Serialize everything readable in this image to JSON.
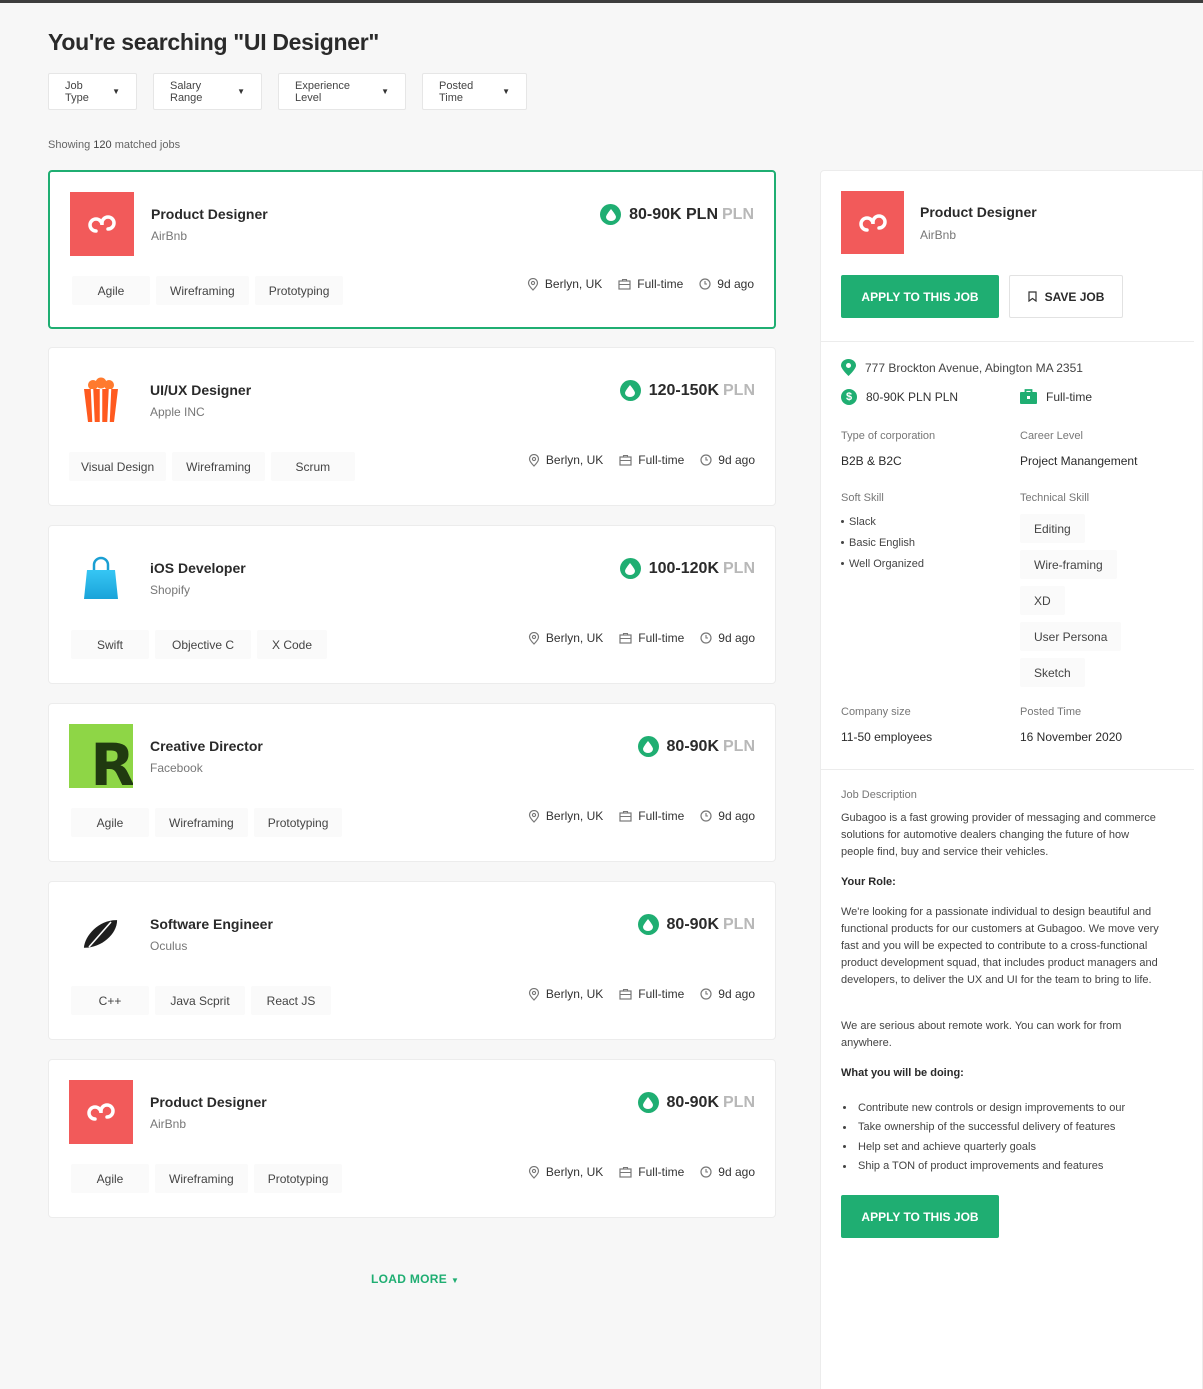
{
  "page": {
    "title": "You're searching \"UI Designer\"",
    "results_prefix": "Showing",
    "results_count": "120",
    "results_suffix": "matched jobs",
    "load_more": "LOAD MORE"
  },
  "filters": [
    {
      "label": "Job Type"
    },
    {
      "label": "Salary Range"
    },
    {
      "label": "Experience Level"
    },
    {
      "label": "Posted Time"
    }
  ],
  "jobs": [
    {
      "title": "Product Designer",
      "company": "AirBnb",
      "salary": "80-90K PLN",
      "currency": "PLN",
      "tags": [
        "Agile",
        "Wireframing",
        "Prototyping"
      ],
      "location": "Berlyn, UK",
      "type": "Full-time",
      "posted": "9d ago",
      "logo": "airbnb-logo"
    },
    {
      "title": "UI/UX Designer",
      "company": "Apple INC",
      "salary": "120-150K",
      "currency": "PLN",
      "tags": [
        "Visual Design",
        "Wireframing",
        "Scrum"
      ],
      "location": "Berlyn, UK",
      "type": "Full-time",
      "posted": "9d ago",
      "logo": "popcorn-logo"
    },
    {
      "title": "iOS Developer",
      "company": "Shopify",
      "salary": "100-120K",
      "currency": "PLN",
      "tags": [
        "Swift",
        "Objective C",
        "X Code"
      ],
      "location": "Berlyn, UK",
      "type": "Full-time",
      "posted": "9d ago",
      "logo": "shopping-bag-logo"
    },
    {
      "title": "Creative Director",
      "company": "Facebook",
      "salary": "80-90K",
      "currency": "PLN",
      "tags": [
        "Agile",
        "Wireframing",
        "Prototyping"
      ],
      "location": "Berlyn, UK",
      "type": "Full-time",
      "posted": "9d ago",
      "logo": "r-letter-logo"
    },
    {
      "title": "Software Engineer",
      "company": "Oculus",
      "salary": "80-90K",
      "currency": "PLN",
      "tags": [
        "C++",
        "Java Scprit",
        "React JS"
      ],
      "location": "Berlyn, UK",
      "type": "Full-time",
      "posted": "9d ago",
      "logo": "leaf-logo"
    },
    {
      "title": "Product Designer",
      "company": "AirBnb",
      "salary": "80-90K",
      "currency": "PLN",
      "tags": [
        "Agile",
        "Wireframing",
        "Prototyping"
      ],
      "location": "Berlyn, UK",
      "type": "Full-time",
      "posted": "9d ago",
      "logo": "airbnb-logo"
    }
  ],
  "detail": {
    "title": "Product Designer",
    "company": "AirBnb",
    "apply_label": "APPLY TO THIS JOB",
    "save_label": "SAVE JOB",
    "address": "777 Brockton Avenue, Abington MA 2351",
    "salary": "80-90K PLN PLN",
    "job_type": "Full-time",
    "corporation_label": "Type of corporation",
    "corporation_value": "B2B & B2C",
    "career_label": "Career Level",
    "career_value": "Project Manangement",
    "soft_label": "Soft Skill",
    "soft_skills": [
      "Slack",
      "Basic English",
      "Well Organized"
    ],
    "tech_label": "Technical Skill",
    "tech_skills": [
      "Editing",
      "Wire-framing",
      "XD",
      "User Persona",
      "Sketch"
    ],
    "size_label": "Company size",
    "size_value": "11-50 employees",
    "posted_label": "Posted Time",
    "posted_value": "16 November 2020",
    "desc_label": "Job Description",
    "desc_intro": "Gubagoo is a fast growing provider of messaging and commerce solutions for automotive dealers changing the future of how people find, buy and service their vehicles.",
    "role_label": "Your Role:",
    "role_text": "We're looking for a passionate individual to design beautiful and functional products for our customers at Gubagoo. We move very fast and you will be expected to contribute to a cross-functional product development squad, that includes product managers and developers, to deliver the UX and UI for the team to bring to life.",
    "remote_text": "We are serious about remote work. You can work for from anywhere.",
    "doing_label": "What you will be doing:",
    "doing_items": [
      "Contribute new controls or design improvements to our",
      "Take ownership of the successful delivery of features",
      "Help set and achieve quarterly goals",
      "Ship a TON of product improvements and features"
    ]
  },
  "colors": {
    "accent": "#1fae72",
    "airbnb": "#f25a5a",
    "muted": "#b8b8b8"
  }
}
